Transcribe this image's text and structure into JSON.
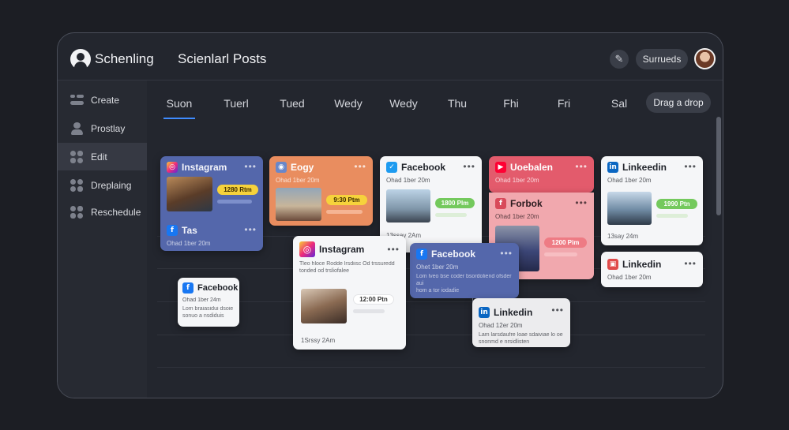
{
  "app": {
    "name": "Schenling",
    "title": "Scienlarl Posts"
  },
  "header": {
    "button_label": "Surrueds"
  },
  "sidebar": {
    "items": [
      {
        "label": "Create",
        "icon": "create-icon"
      },
      {
        "label": "Prostlay",
        "icon": "user-icon"
      },
      {
        "label": "Edit",
        "icon": "edit-grid-icon",
        "active": true
      },
      {
        "label": "Dreplaing",
        "icon": "drafts-icon"
      },
      {
        "label": "Reschedule",
        "icon": "reschedule-icon"
      }
    ]
  },
  "days": [
    "Suon",
    "Tuerl",
    "Tued",
    "Wedy",
    "Wedy",
    "Thu",
    "Fhi",
    "Fri",
    "Sal"
  ],
  "drag_label": "Drag a drop",
  "cards": {
    "c1": {
      "title": "Instagram",
      "time": "1280 Rtm"
    },
    "c1b": {
      "title": "Tas",
      "meta": "Ohad 1ber 20m"
    },
    "c2": {
      "title": "Eogy",
      "meta": "Ohad 1ber 20m",
      "time": "9:30 Ptm"
    },
    "c3": {
      "title": "Facebook",
      "meta": "Ohad 1ber 20m",
      "time": "1800 Plm",
      "footer": "13ssay 2Am"
    },
    "c4": {
      "title": "Uoebalen",
      "meta": "Ohad 1ber 20m"
    },
    "c4b": {
      "title": "Forbok",
      "meta": "Ohad 1ber 20m",
      "time": "1200 Pim"
    },
    "c5": {
      "title": "Linkeedin",
      "meta": "Ohad 1ber 20m",
      "time": "1990 Ptn",
      "footer": "13say 24m"
    },
    "c6": {
      "title": "Linkedin",
      "meta": "Ohad 1ber 20m"
    },
    "c7": {
      "title": "Facebook",
      "meta": "Ohad 1ber 24m",
      "body": "Lom braiasidui dsoie\nsonuo a nsdiduis"
    },
    "c8": {
      "title": "Instagram",
      "body": "Tleo hloce Rodde lrsdiisc Od trssuredd\ntonded od trsliofalee",
      "time": "12:00 Ptn",
      "footer": "1Srssy 2Am"
    },
    "c9": {
      "title": "Facebook",
      "meta": "Ohet 1ber 20m",
      "body": "Lom lveo bse coder bsordoliend ofsder aui\nhom a tor iodadie"
    },
    "c10": {
      "title": "Linkedin",
      "meta": "Ohad 12er 20m",
      "body": "Lam larsdaufre loae sdaiviae lo oe\nsnonmd e nrsidlisten"
    }
  }
}
